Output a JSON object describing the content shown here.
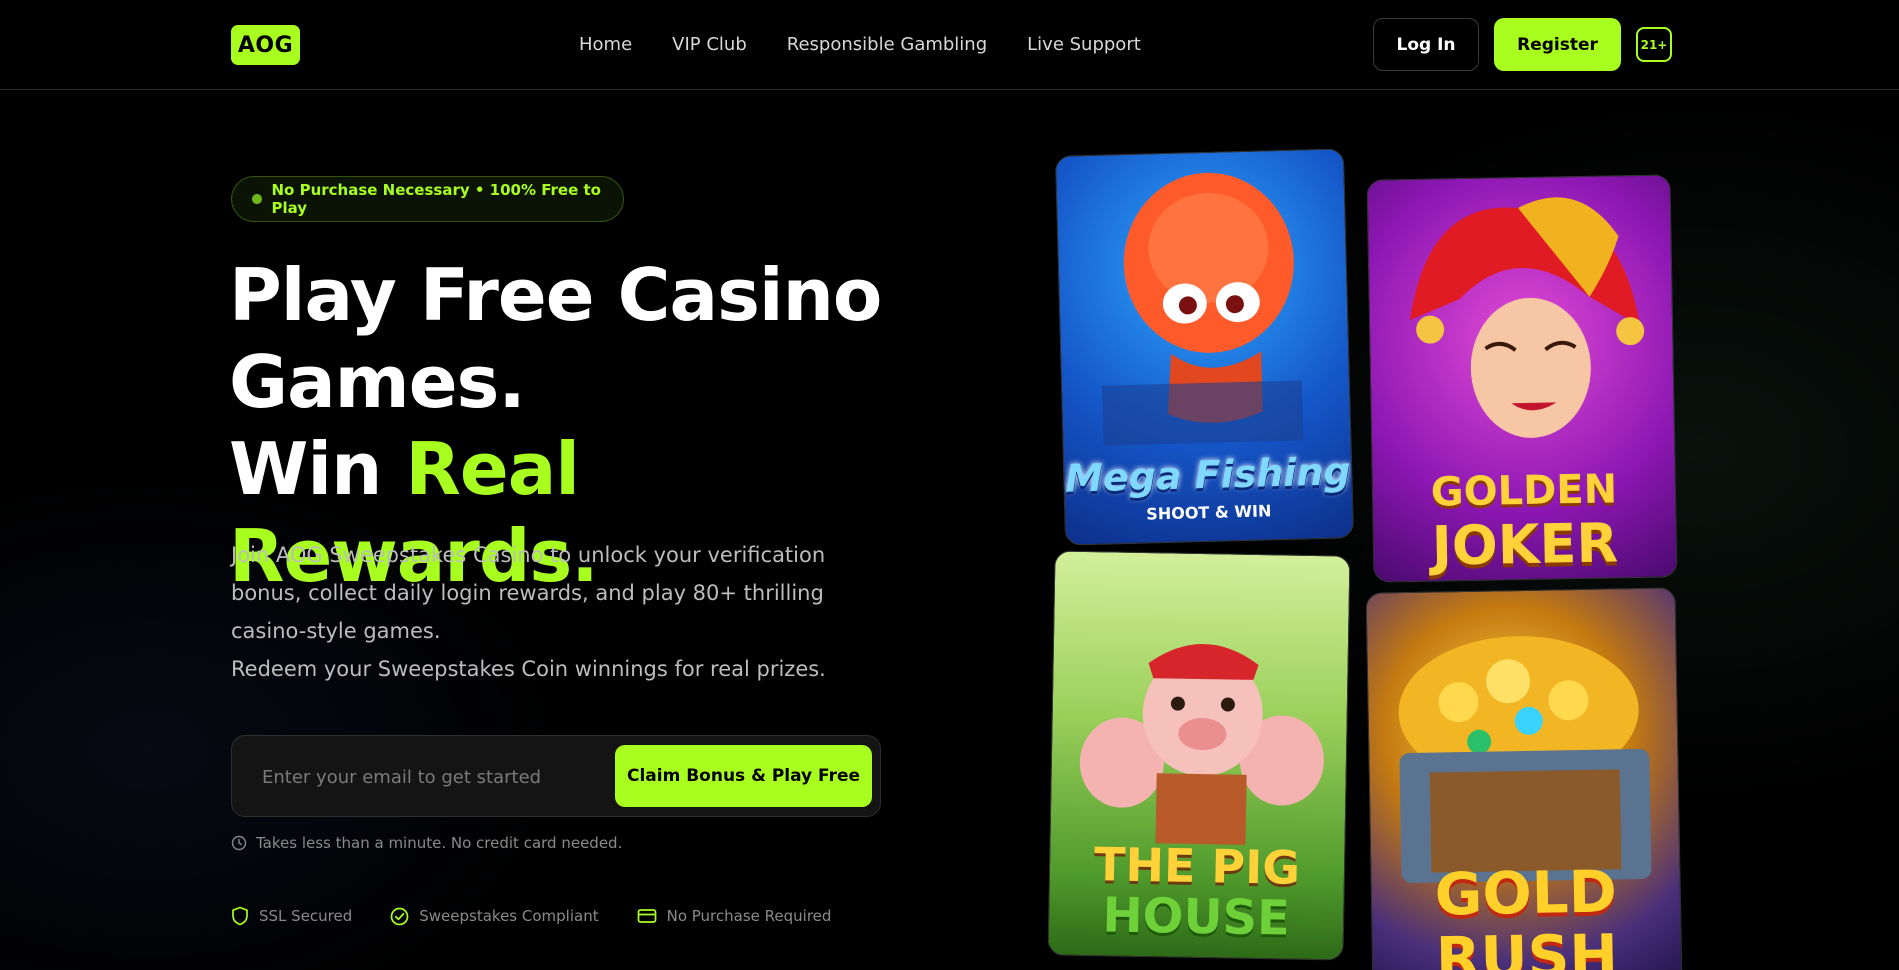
{
  "header": {
    "logo": "AOG",
    "nav": [
      "Home",
      "VIP Club",
      "Responsible Gambling",
      "Live Support"
    ],
    "login_label": "Log In",
    "register_label": "Register",
    "age_badge": "21+"
  },
  "hero": {
    "pill": "No Purchase Necessary • 100% Free to Play",
    "headline_line1": "Play Free Casino",
    "headline_line2": "Games.",
    "headline_line3_white": "Win ",
    "headline_line3_accent": "Real Rewards.",
    "subtext_1": "Join AOG Sweepstakes Casino to unlock your verification bonus, collect daily login rewards, and play 80+ thrilling casino-style games.",
    "subtext_2": "Redeem your Sweepstakes Coin winnings for real prizes.",
    "email_placeholder": "Enter your email to get started",
    "cta_label": "Claim Bonus & Play Free",
    "note": "Takes less than a minute. No credit card needed.",
    "trust": [
      "SSL Secured",
      "Sweepstakes Compliant",
      "No Purchase Required"
    ]
  },
  "games": [
    {
      "title": "Mega Fishing",
      "subtitle": "SHOOT & WIN"
    },
    {
      "title_line1": "GOLDEN",
      "title_line2": "JOKER"
    },
    {
      "title_line1": "THE PIG",
      "title_line2": "HOUSE"
    },
    {
      "title": "GOLD RUSH"
    }
  ],
  "colors": {
    "accent": "#a8ff1f",
    "background": "#000000"
  }
}
